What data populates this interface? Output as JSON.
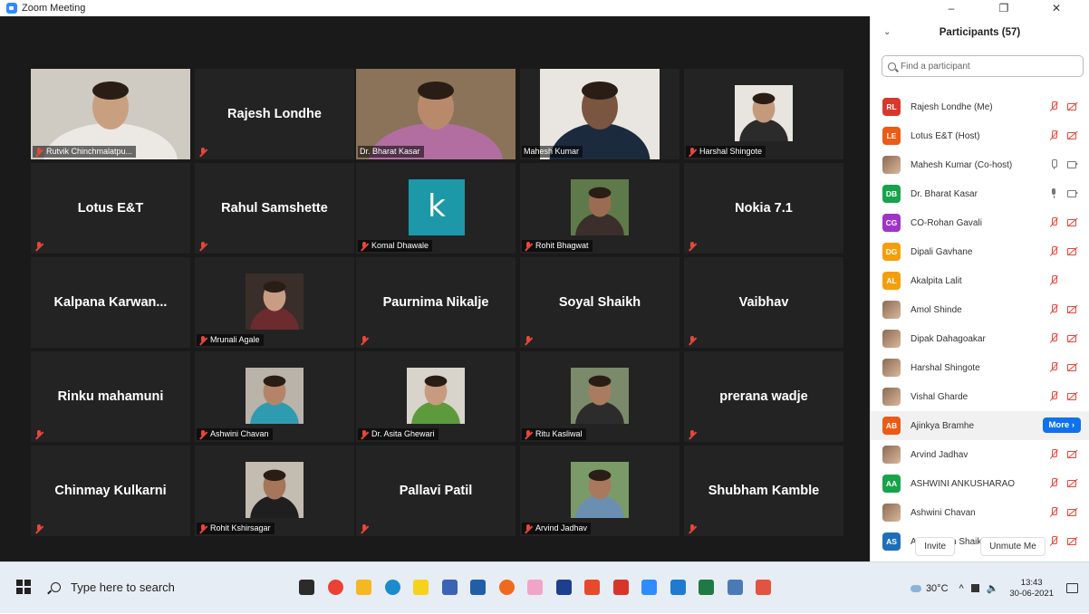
{
  "window": {
    "title": "Zoom Meeting",
    "controls": [
      "–",
      "❐",
      "✕"
    ]
  },
  "tiles": [
    {
      "name": "Rutvik Chinchmalatpu...",
      "display": "",
      "kind": "video",
      "muted": true,
      "bg": "#cfcac2",
      "skin": "#c9a07f",
      "shirt": "#ece9e4"
    },
    {
      "name": "",
      "display": "Rajesh Londhe",
      "kind": "text",
      "muted": true
    },
    {
      "name": "Dr. Bharat Kasar",
      "display": "",
      "kind": "video",
      "muted": false,
      "active": true,
      "bg": "#8a7358",
      "skin": "#b88a6b",
      "shirt": "#b26ea0"
    },
    {
      "name": "Mahesh Kumar",
      "display": "",
      "kind": "video",
      "muted": false,
      "bg": "#e9e6e1",
      "skin": "#7a5540",
      "shirt": "#1c2a3d"
    },
    {
      "name": "Harshal Shingote",
      "display": "",
      "kind": "photo",
      "muted": true,
      "bg": "#e8e4df",
      "skin": "#c49a7c",
      "shirt": "#2b2b2b"
    },
    {
      "name": "",
      "display": "Lotus E&T",
      "kind": "text",
      "muted": true
    },
    {
      "name": "",
      "display": "Rahul Samshette",
      "kind": "text",
      "muted": true
    },
    {
      "name": "Komal Dhawale",
      "display": "k",
      "kind": "letter",
      "muted": true
    },
    {
      "name": "Rohit Bhagwat",
      "display": "",
      "kind": "photo",
      "muted": true,
      "bg": "#5f7a4a",
      "skin": "#9a6d52",
      "shirt": "#3a2f2b"
    },
    {
      "name": "",
      "display": "Nokia 7.1",
      "kind": "text",
      "muted": true
    },
    {
      "name": "",
      "display": "Kalpana  Karwan...",
      "kind": "text",
      "muted": false
    },
    {
      "name": "Mrunali Agale",
      "display": "",
      "kind": "photo",
      "muted": true,
      "bg": "#3a2e2a",
      "skin": "#c99d83",
      "shirt": "#6b2b2f"
    },
    {
      "name": "",
      "display": "Paurnima Nikalje",
      "kind": "text",
      "muted": true
    },
    {
      "name": "",
      "display": "Soyal Shaikh",
      "kind": "text",
      "muted": true
    },
    {
      "name": "",
      "display": "Vaibhav",
      "kind": "text",
      "muted": true
    },
    {
      "name": "",
      "display": "Rinku mahamuni",
      "kind": "text",
      "muted": true
    },
    {
      "name": "Ashwini Chavan",
      "display": "",
      "kind": "photo",
      "muted": true,
      "bg": "#b9b3aa",
      "skin": "#b58468",
      "shirt": "#2f9bb0"
    },
    {
      "name": "Dr. Asita Ghewari",
      "display": "",
      "kind": "photo",
      "muted": true,
      "bg": "#d8d4cc",
      "skin": "#c79b7e",
      "shirt": "#5c9a3b"
    },
    {
      "name": "Ritu Kasliwal",
      "display": "",
      "kind": "photo",
      "muted": true,
      "bg": "#7b8a6a",
      "skin": "#a97c60",
      "shirt": "#2c2c2c"
    },
    {
      "name": "",
      "display": "prerana wadje",
      "kind": "text",
      "muted": true
    },
    {
      "name": "",
      "display": "Chinmay Kulkarni",
      "kind": "text",
      "muted": true
    },
    {
      "name": "Rohit Kshirsagar",
      "display": "",
      "kind": "photo",
      "muted": true,
      "bg": "#c3bcb1",
      "skin": "#a5765a",
      "shirt": "#1f1f1f"
    },
    {
      "name": "",
      "display": "Pallavi Patil",
      "kind": "text",
      "muted": true
    },
    {
      "name": "Arvind Jadhav",
      "display": "",
      "kind": "photo",
      "muted": true,
      "bg": "#7a9b67",
      "skin": "#a8795c",
      "shirt": "#6b8fb3"
    },
    {
      "name": "",
      "display": "Shubham Kamble",
      "kind": "text",
      "muted": true
    }
  ],
  "participants": {
    "title": "Participants (57)",
    "search_placeholder": "Find a participant",
    "more_label": "More ›",
    "invite_label": "Invite",
    "unmute_label": "Unmute Me",
    "list": [
      {
        "initials": "RL",
        "name": "Rajesh Londhe (Me)",
        "color": "#d9372b",
        "mic": "off",
        "cam": "off"
      },
      {
        "initials": "LE",
        "name": "Lotus E&T (Host)",
        "color": "#ec5a13",
        "mic": "off",
        "cam": "off"
      },
      {
        "initials": "",
        "name": "Mahesh Kumar (Co-host)",
        "color": "pic",
        "mic": "on",
        "cam": "on"
      },
      {
        "initials": "DB",
        "name": "Dr. Bharat Kasar",
        "color": "#16a34a",
        "mic": "active",
        "cam": "on"
      },
      {
        "initials": "CG",
        "name": "CO-Rohan Gavali",
        "color": "#a133c7",
        "mic": "off",
        "cam": "off"
      },
      {
        "initials": "DG",
        "name": "Dipali Gavhane",
        "color": "#f59e0b",
        "mic": "off",
        "cam": "off"
      },
      {
        "initials": "AL",
        "name": "Akalpita Lalit",
        "color": "#f59e0b",
        "mic": "off",
        "cam": "none"
      },
      {
        "initials": "",
        "name": "Amol Shinde",
        "color": "pic",
        "mic": "off",
        "cam": "off"
      },
      {
        "initials": "",
        "name": "Dipak Dahagoakar",
        "color": "pic",
        "mic": "off",
        "cam": "off"
      },
      {
        "initials": "",
        "name": "Harshal Shingote",
        "color": "pic",
        "mic": "off",
        "cam": "off"
      },
      {
        "initials": "",
        "name": "Vishal Gharde",
        "color": "pic",
        "mic": "off",
        "cam": "off"
      },
      {
        "initials": "AB",
        "name": "Ajinkya Bramhe",
        "color": "#ec5a13",
        "mic": "more",
        "cam": "more"
      },
      {
        "initials": "",
        "name": "Arvind Jadhav",
        "color": "pic",
        "mic": "off",
        "cam": "off"
      },
      {
        "initials": "AA",
        "name": "ASHWINI ANKUSHARAO",
        "color": "#16a34a",
        "mic": "off",
        "cam": "off"
      },
      {
        "initials": "",
        "name": "Ashwini Chavan",
        "color": "pic",
        "mic": "off",
        "cam": "off"
      },
      {
        "initials": "AS",
        "name": "Azharuddin Shaikh",
        "color": "#1e6fb8",
        "mic": "off",
        "cam": "off"
      }
    ]
  },
  "taskbar": {
    "search_placeholder": "Type here to search",
    "icons": [
      {
        "name": "task-view-icon",
        "color": "#2b2b2b"
      },
      {
        "name": "chrome-icon",
        "color": "#e94235"
      },
      {
        "name": "file-explorer-icon",
        "color": "#f3b822"
      },
      {
        "name": "edge-icon",
        "color": "#1a8ccb"
      },
      {
        "name": "sticky-notes-icon",
        "color": "#f6d21b"
      },
      {
        "name": "app-icon",
        "color": "#3a62b5"
      },
      {
        "name": "mail-icon",
        "color": "#1f5fa8"
      },
      {
        "name": "firefox-icon",
        "color": "#f06a1d"
      },
      {
        "name": "paint-icon",
        "color": "#f2a4c8"
      },
      {
        "name": "powerpoint-icon",
        "color": "#1c3f8f"
      },
      {
        "name": "office-icon",
        "color": "#e8492b"
      },
      {
        "name": "app-icon-2",
        "color": "#d9342b"
      },
      {
        "name": "zoom-icon",
        "color": "#2d8cff"
      },
      {
        "name": "vscode-icon",
        "color": "#1f7ad1"
      },
      {
        "name": "excel-icon",
        "color": "#1e7a43"
      },
      {
        "name": "notepad-icon",
        "color": "#4a7bb7"
      },
      {
        "name": "photos-icon",
        "color": "#e1543f"
      }
    ],
    "weather": "30°C",
    "time": "13:43",
    "date": "30-06-2021"
  }
}
